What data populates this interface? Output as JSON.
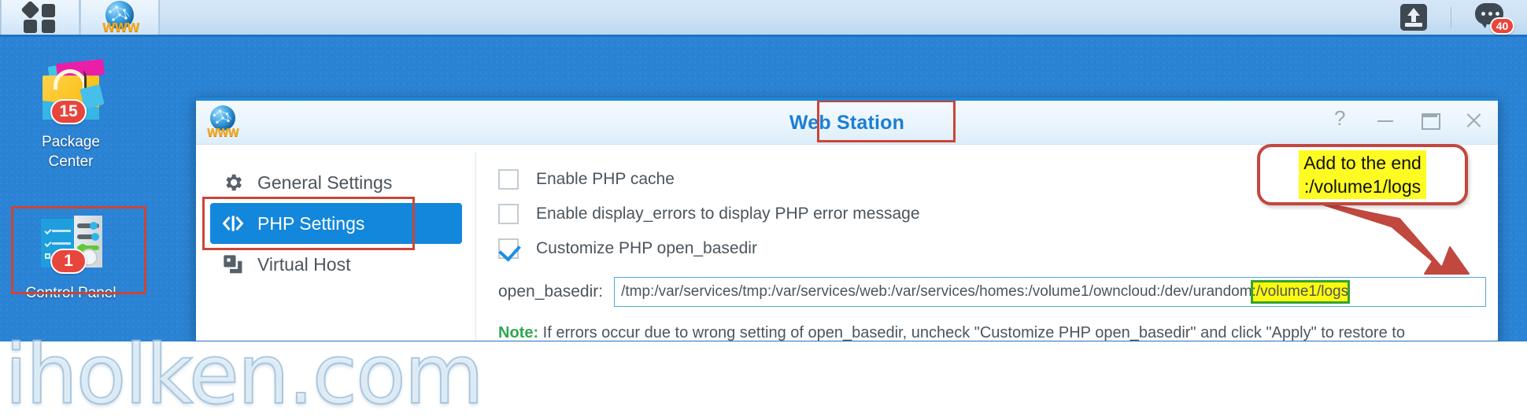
{
  "taskbar": {
    "apps_button": "main-menu",
    "app_button": "web-station",
    "upload_label": "upload",
    "chat_label": "notifications",
    "notification_count": "40"
  },
  "desktop": {
    "icons": [
      {
        "label_line1": "Package",
        "label_line2": "Center",
        "badge": "15",
        "name": "package-center"
      },
      {
        "label_line1": "Control Panel",
        "label_line2": "",
        "badge": "1",
        "name": "control-panel"
      }
    ]
  },
  "window": {
    "title": "Web Station",
    "controls": {
      "help": "?",
      "minimize": "—",
      "maximize": "□",
      "close": "✕"
    }
  },
  "sidebar": {
    "items": [
      {
        "label": "General Settings",
        "icon": "gear-icon",
        "active": false
      },
      {
        "label": "PHP Settings",
        "icon": "code-icon",
        "active": true
      },
      {
        "label": "Virtual Host",
        "icon": "windows-stack-icon",
        "active": false
      }
    ]
  },
  "settings": {
    "checkboxes": [
      {
        "label": "Enable PHP cache",
        "checked": false
      },
      {
        "label": "Enable display_errors to display PHP error message",
        "checked": false
      },
      {
        "label": "Customize PHP open_basedir",
        "checked": true
      }
    ],
    "open_basedir": {
      "label": "open_basedir:",
      "value_base": "/tmp:/var/services/tmp:/var/services/web:/var/services/homes:/volume1/owncloud:/dev/urandom",
      "value_highlighted": ":/volume1/logs",
      "value_full": "/tmp:/var/services/tmp:/var/services/web:/var/services/homes:/volume1/owncloud:/dev/urandom:/volume1/logs"
    },
    "note": {
      "prefix": "Note:",
      "text": " If errors occur due to wrong setting of open_basedir, uncheck \"Customize PHP open_basedir\" and click \"Apply\" to restore to system default."
    }
  },
  "annotations": {
    "callout_line1": "Add to the end",
    "callout_line2": ":/volume1/logs",
    "highlight_color": "#fcf90e",
    "box_color": "#cb4537"
  },
  "watermark": {
    "text": "iholken.com"
  }
}
